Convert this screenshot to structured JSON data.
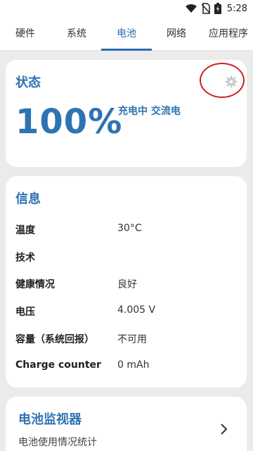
{
  "status_bar": {
    "time": "5:28",
    "icons": [
      "wifi-icon",
      "no-sim-icon",
      "battery-charging-icon"
    ]
  },
  "tabs": [
    {
      "label": "硬件",
      "active": false
    },
    {
      "label": "系统",
      "active": false
    },
    {
      "label": "电池",
      "active": true
    },
    {
      "label": "网络",
      "active": false
    },
    {
      "label": "应用程序",
      "active": false
    }
  ],
  "status_card": {
    "title": "状态",
    "level": "100%",
    "charge_state": "充电中 交流电",
    "settings_icon": "gear-icon"
  },
  "info_card": {
    "title": "信息",
    "rows": [
      {
        "label": "温度",
        "value": "30°C"
      },
      {
        "label": "技术",
        "value": ""
      },
      {
        "label": "健康情况",
        "value": "良好"
      },
      {
        "label": "电压",
        "value": "4.005 V"
      },
      {
        "label": "容量（系统回报）",
        "value": "不可用"
      },
      {
        "label": "Charge counter",
        "value": "0 mAh"
      }
    ]
  },
  "monitor_card": {
    "title": "电池监视器",
    "subtitle": "电池使用情况统计",
    "icon": "chevron-right-icon"
  },
  "colors": {
    "accent": "#2f73b3",
    "annotation": "#cc2222",
    "background": "#ebebeb",
    "card": "#ffffff"
  }
}
